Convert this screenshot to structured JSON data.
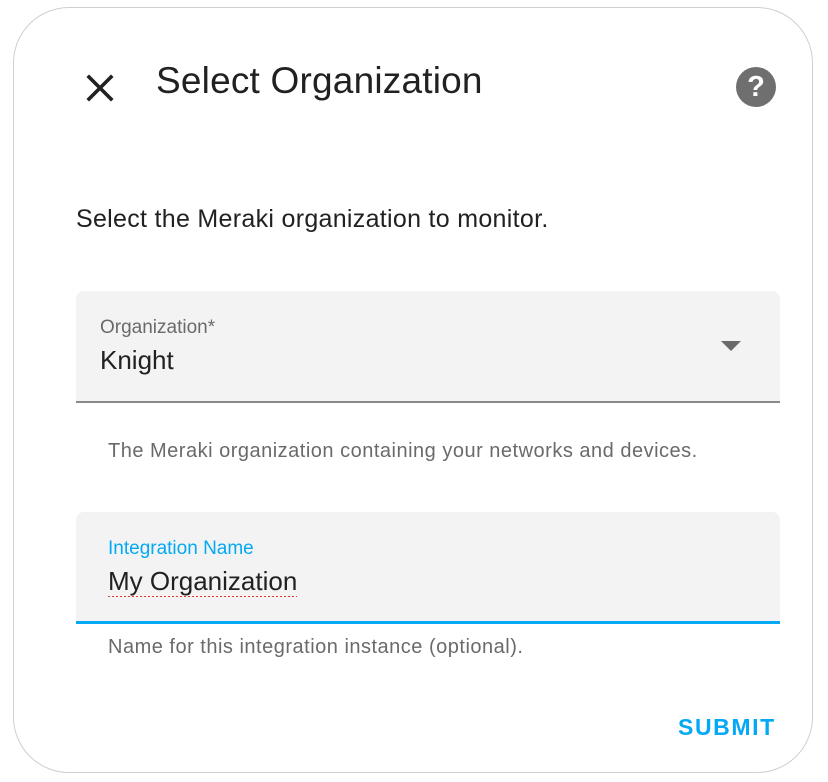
{
  "dialog": {
    "title": "Select Organization",
    "description": "Select the Meraki organization to monitor.",
    "close_icon": "close-icon",
    "help_icon": "help-icon",
    "help_glyph": "?"
  },
  "organization_field": {
    "label": "Organization*",
    "value": "Knight",
    "helper": "The Meraki organization containing your networks and devices.",
    "icon": "chevron-down-icon"
  },
  "name_field": {
    "label": "Integration Name",
    "value": "My Organization",
    "helper": "Name for this integration instance (optional)."
  },
  "actions": {
    "submit_label": "SUBMIT"
  },
  "colors": {
    "accent": "#03a9f4",
    "text": "#212121",
    "secondary_text": "#6a6a6a",
    "field_background": "#f3f3f3",
    "spellcheck_underline": "#e53935"
  }
}
